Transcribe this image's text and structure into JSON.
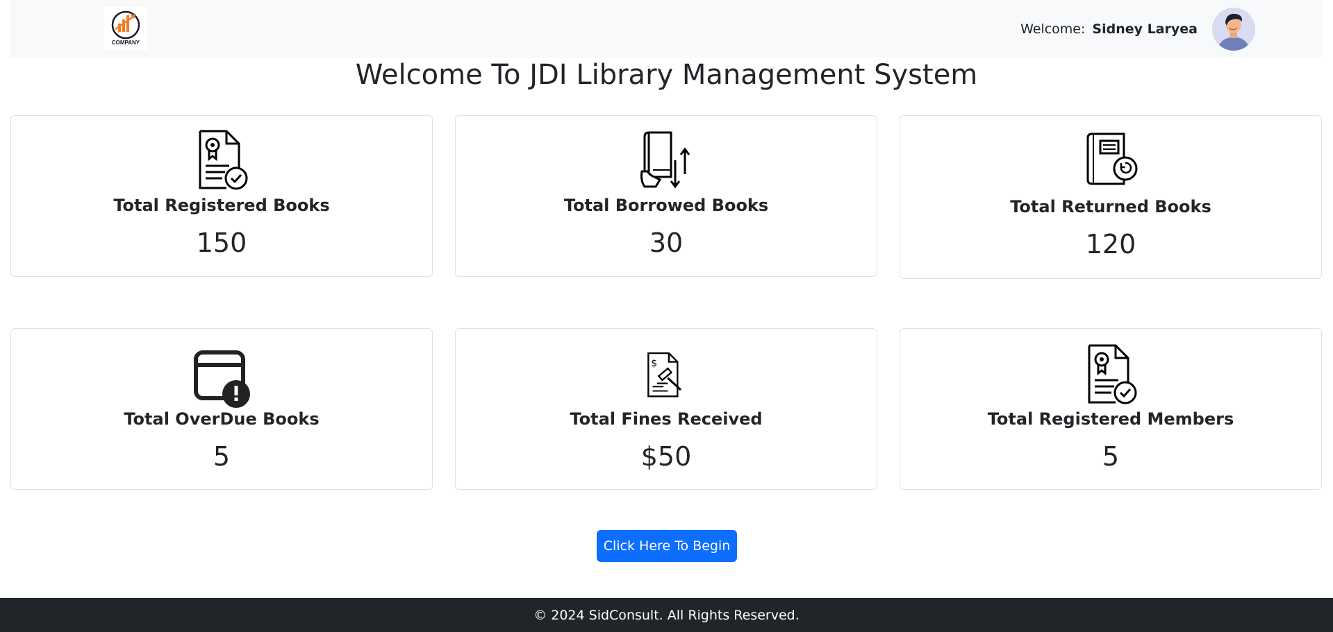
{
  "header": {
    "logo_text": "COMPANY",
    "welcome_label": "Welcome:",
    "user_name": "Sidney Laryea"
  },
  "page_title": "Welcome To JDI Library Management System",
  "stats": [
    {
      "label": "Total Registered Books",
      "value": "150",
      "icon": "certificate-document-icon"
    },
    {
      "label": "Total Borrowed Books",
      "value": "30",
      "icon": "book-borrow-arrows-icon"
    },
    {
      "label": "Total Returned Books",
      "value": "120",
      "icon": "book-return-icon"
    },
    {
      "label": "Total OverDue Books",
      "value": "5",
      "icon": "calendar-alert-icon"
    },
    {
      "label": "Total Fines Received",
      "value": "$50",
      "icon": "gavel-document-icon"
    },
    {
      "label": "Total Registered Members",
      "value": "5",
      "icon": "certificate-document-icon"
    }
  ],
  "cta": {
    "label": "Click Here To Begin"
  },
  "footer": {
    "text": "© 2024 SidConsult. All Rights Reserved."
  },
  "colors": {
    "primary": "#0d6efd",
    "navbar_bg": "#f8f9fa",
    "footer_bg": "#212529",
    "logo_accent": "#f47b20"
  }
}
